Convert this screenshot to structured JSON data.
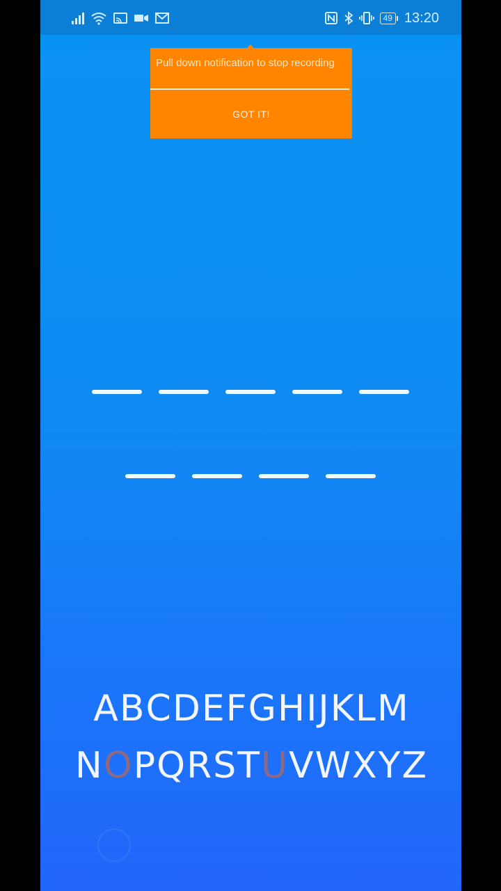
{
  "status_bar": {
    "left_icons": [
      "signal-icon",
      "wifi-icon",
      "cast-icon",
      "video-icon",
      "mail-icon"
    ],
    "right_icons": [
      "nfc-icon",
      "bluetooth-icon",
      "vibrate-icon"
    ],
    "battery": "49",
    "time": "13:20"
  },
  "tooltip": {
    "message": "Pull down notification to stop recording",
    "button_label": "GOT IT!",
    "background": "#ff8500"
  },
  "word_blanks": {
    "row1_count": 5,
    "row2_count": 4
  },
  "keyboard": {
    "row1": [
      "A",
      "B",
      "C",
      "D",
      "E",
      "F",
      "G",
      "H",
      "I",
      "J",
      "K",
      "L",
      "M"
    ],
    "row2": [
      "N",
      "O",
      "P",
      "Q",
      "R",
      "S",
      "T",
      "U",
      "V",
      "W",
      "X",
      "Y",
      "Z"
    ],
    "used_letters": [
      "O",
      "U"
    ],
    "used_color": "#8d6a84"
  }
}
